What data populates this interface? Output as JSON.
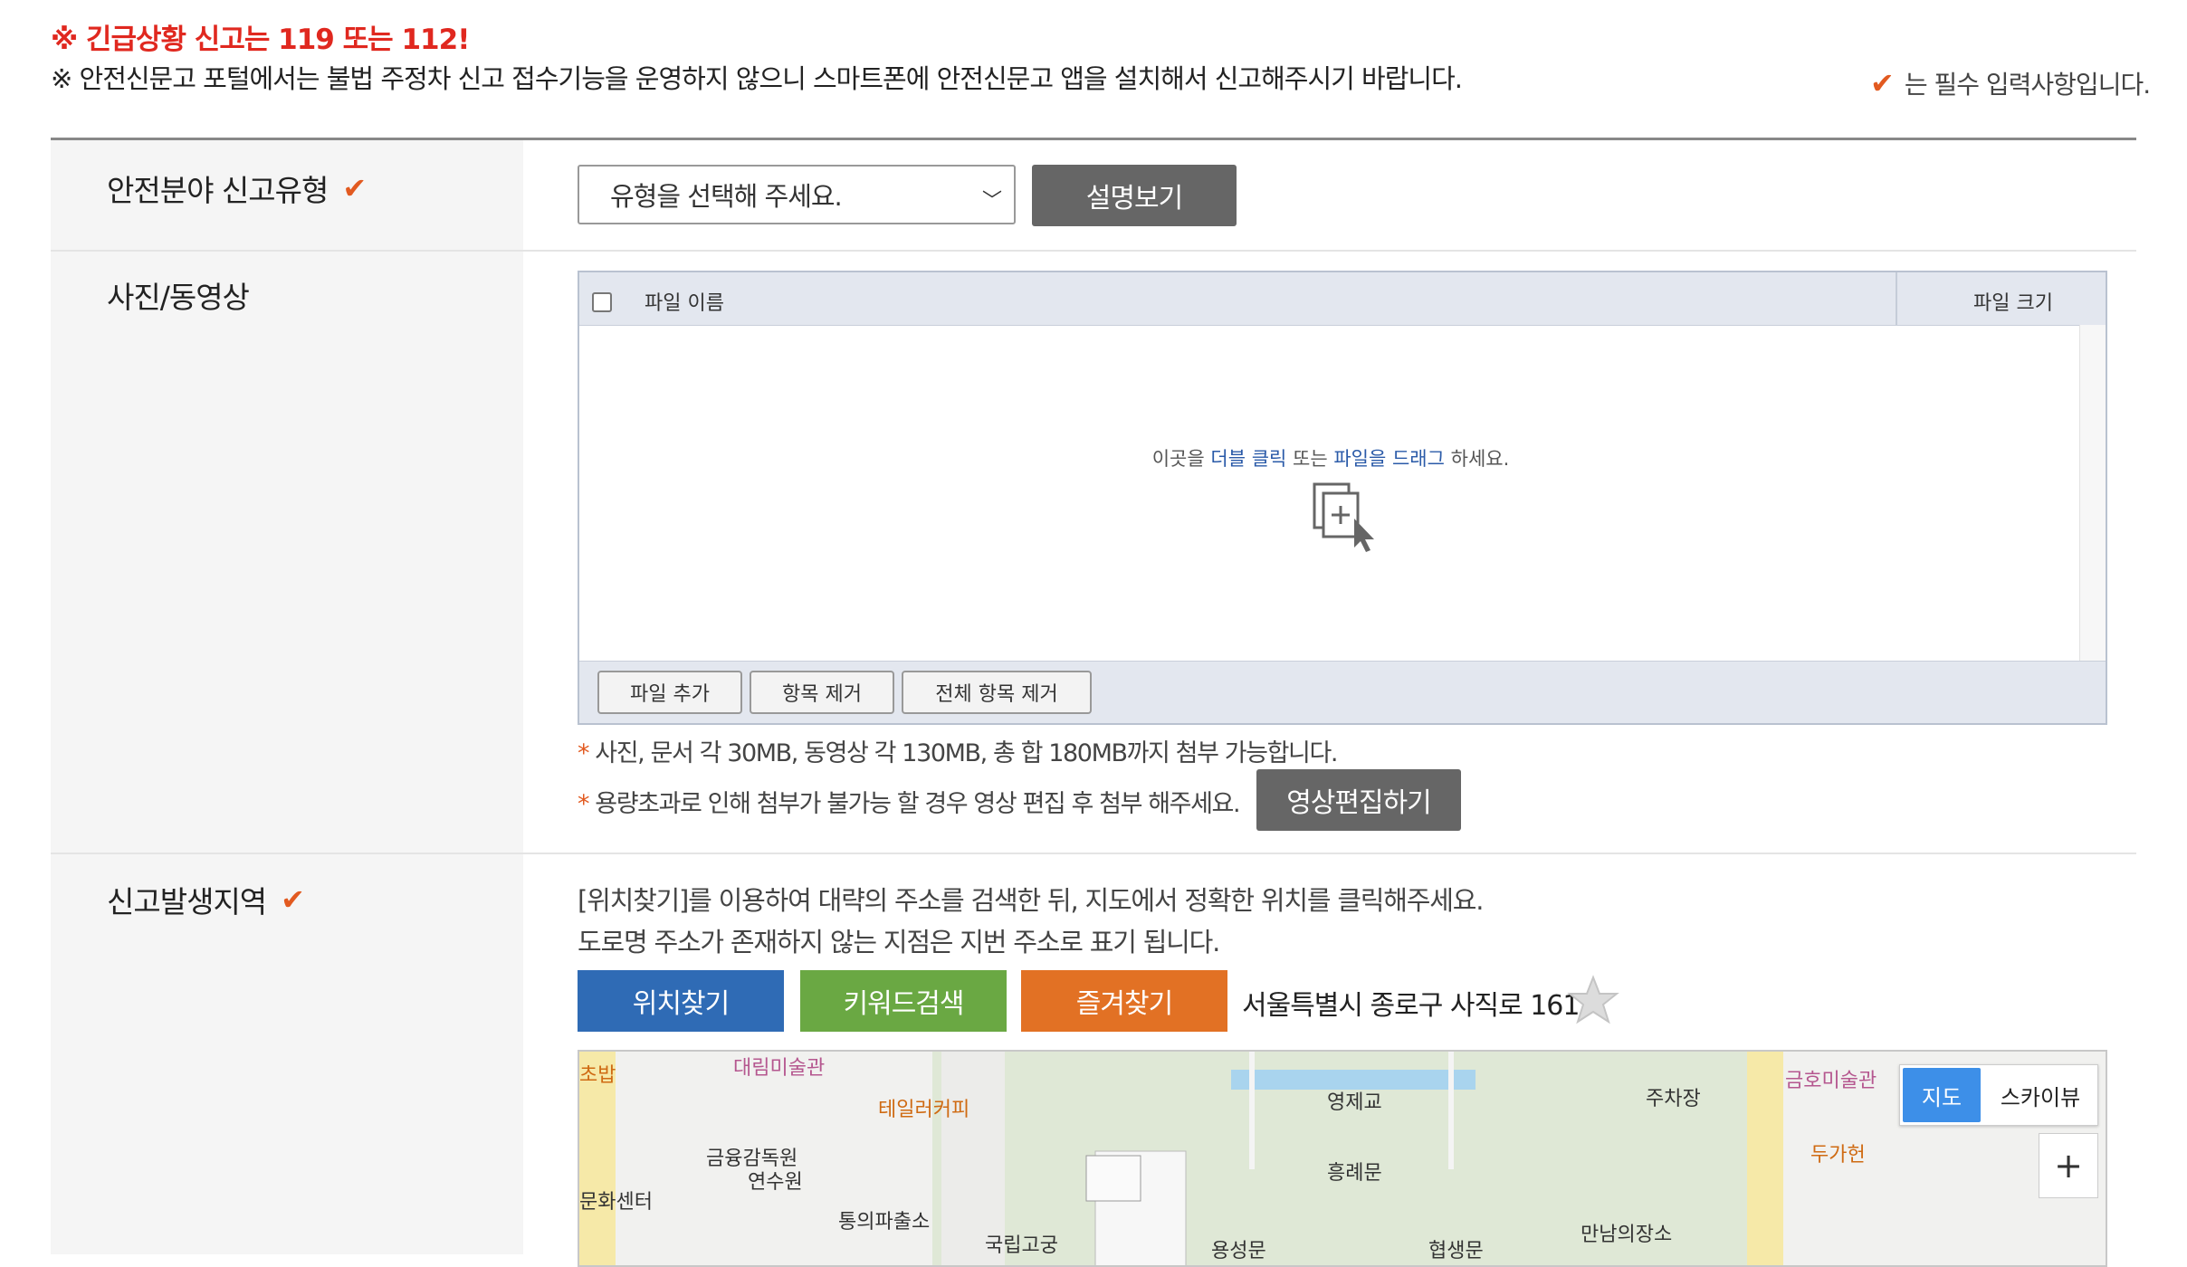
{
  "header": {
    "emergency": "※ 긴급상황 신고는 119 또는 112!",
    "notice": "※ 안전신문고 포털에서는 불법 주정차 신고 접수기능을 운영하지 않으니 스마트폰에 안전신문고 앱을 설치해서 신고해주시기 바랍니다.",
    "required_note": "는 필수 입력사항입니다."
  },
  "colors": {
    "accent_check": "#e25a20",
    "emergency_red": "#e0281f",
    "btn_blue": "#2f6bb5",
    "btn_green": "#6aa843",
    "btn_orange": "#e27124"
  },
  "report_type": {
    "label": "안전분야 신고유형",
    "select_value": "유형을 선택해 주세요.",
    "explain_button": "설명보기"
  },
  "media": {
    "label": "사진/동영상",
    "col_name": "파일 이름",
    "col_size": "파일 크기",
    "hint_pre": "이곳을 ",
    "hint_dbl": "더블 클릭",
    "hint_mid": " 또는 ",
    "hint_drag": "파일을 드래그",
    "hint_post": " 하세요.",
    "btn_add": "파일 추가",
    "btn_remove": "항목 제거",
    "btn_remove_all": "전체 항목 제거",
    "note1": "사진, 문서 각 30MB, 동영상 각 130MB, 총 합 180MB까지 첨부 가능합니다.",
    "note2": "용량초과로 인해 첨부가 불가능 할 경우 영상 편집 후 첨부 해주세요.",
    "edit_button": "영상편집하기"
  },
  "location": {
    "label": "신고발생지역",
    "desc1": "[위치찾기]를 이용하여 대략의 주소를 검색한 뒤, 지도에서 정확한 위치를 클릭해주세요.",
    "desc2": "도로명 주소가 존재하지 않는 지점은 지번 주소로 표기 됩니다.",
    "btn_find": "위치찾기",
    "btn_keyword": "키워드검색",
    "btn_favorite": "즐겨찾기",
    "address": "서울특별시 종로구 사직로 161"
  },
  "map": {
    "toggle_map": "지도",
    "toggle_sky": "스카이뷰",
    "zoom_in": "+",
    "labels": [
      "초밥",
      "대림미술관",
      "테일러커피",
      "금융감독원",
      "연수원",
      "문화센터",
      "통의파출소",
      "국립고궁",
      "영제교",
      "흥례문",
      "용성문",
      "협생문",
      "주차장",
      "금호미술관",
      "두가헌",
      "만남의장소"
    ]
  }
}
